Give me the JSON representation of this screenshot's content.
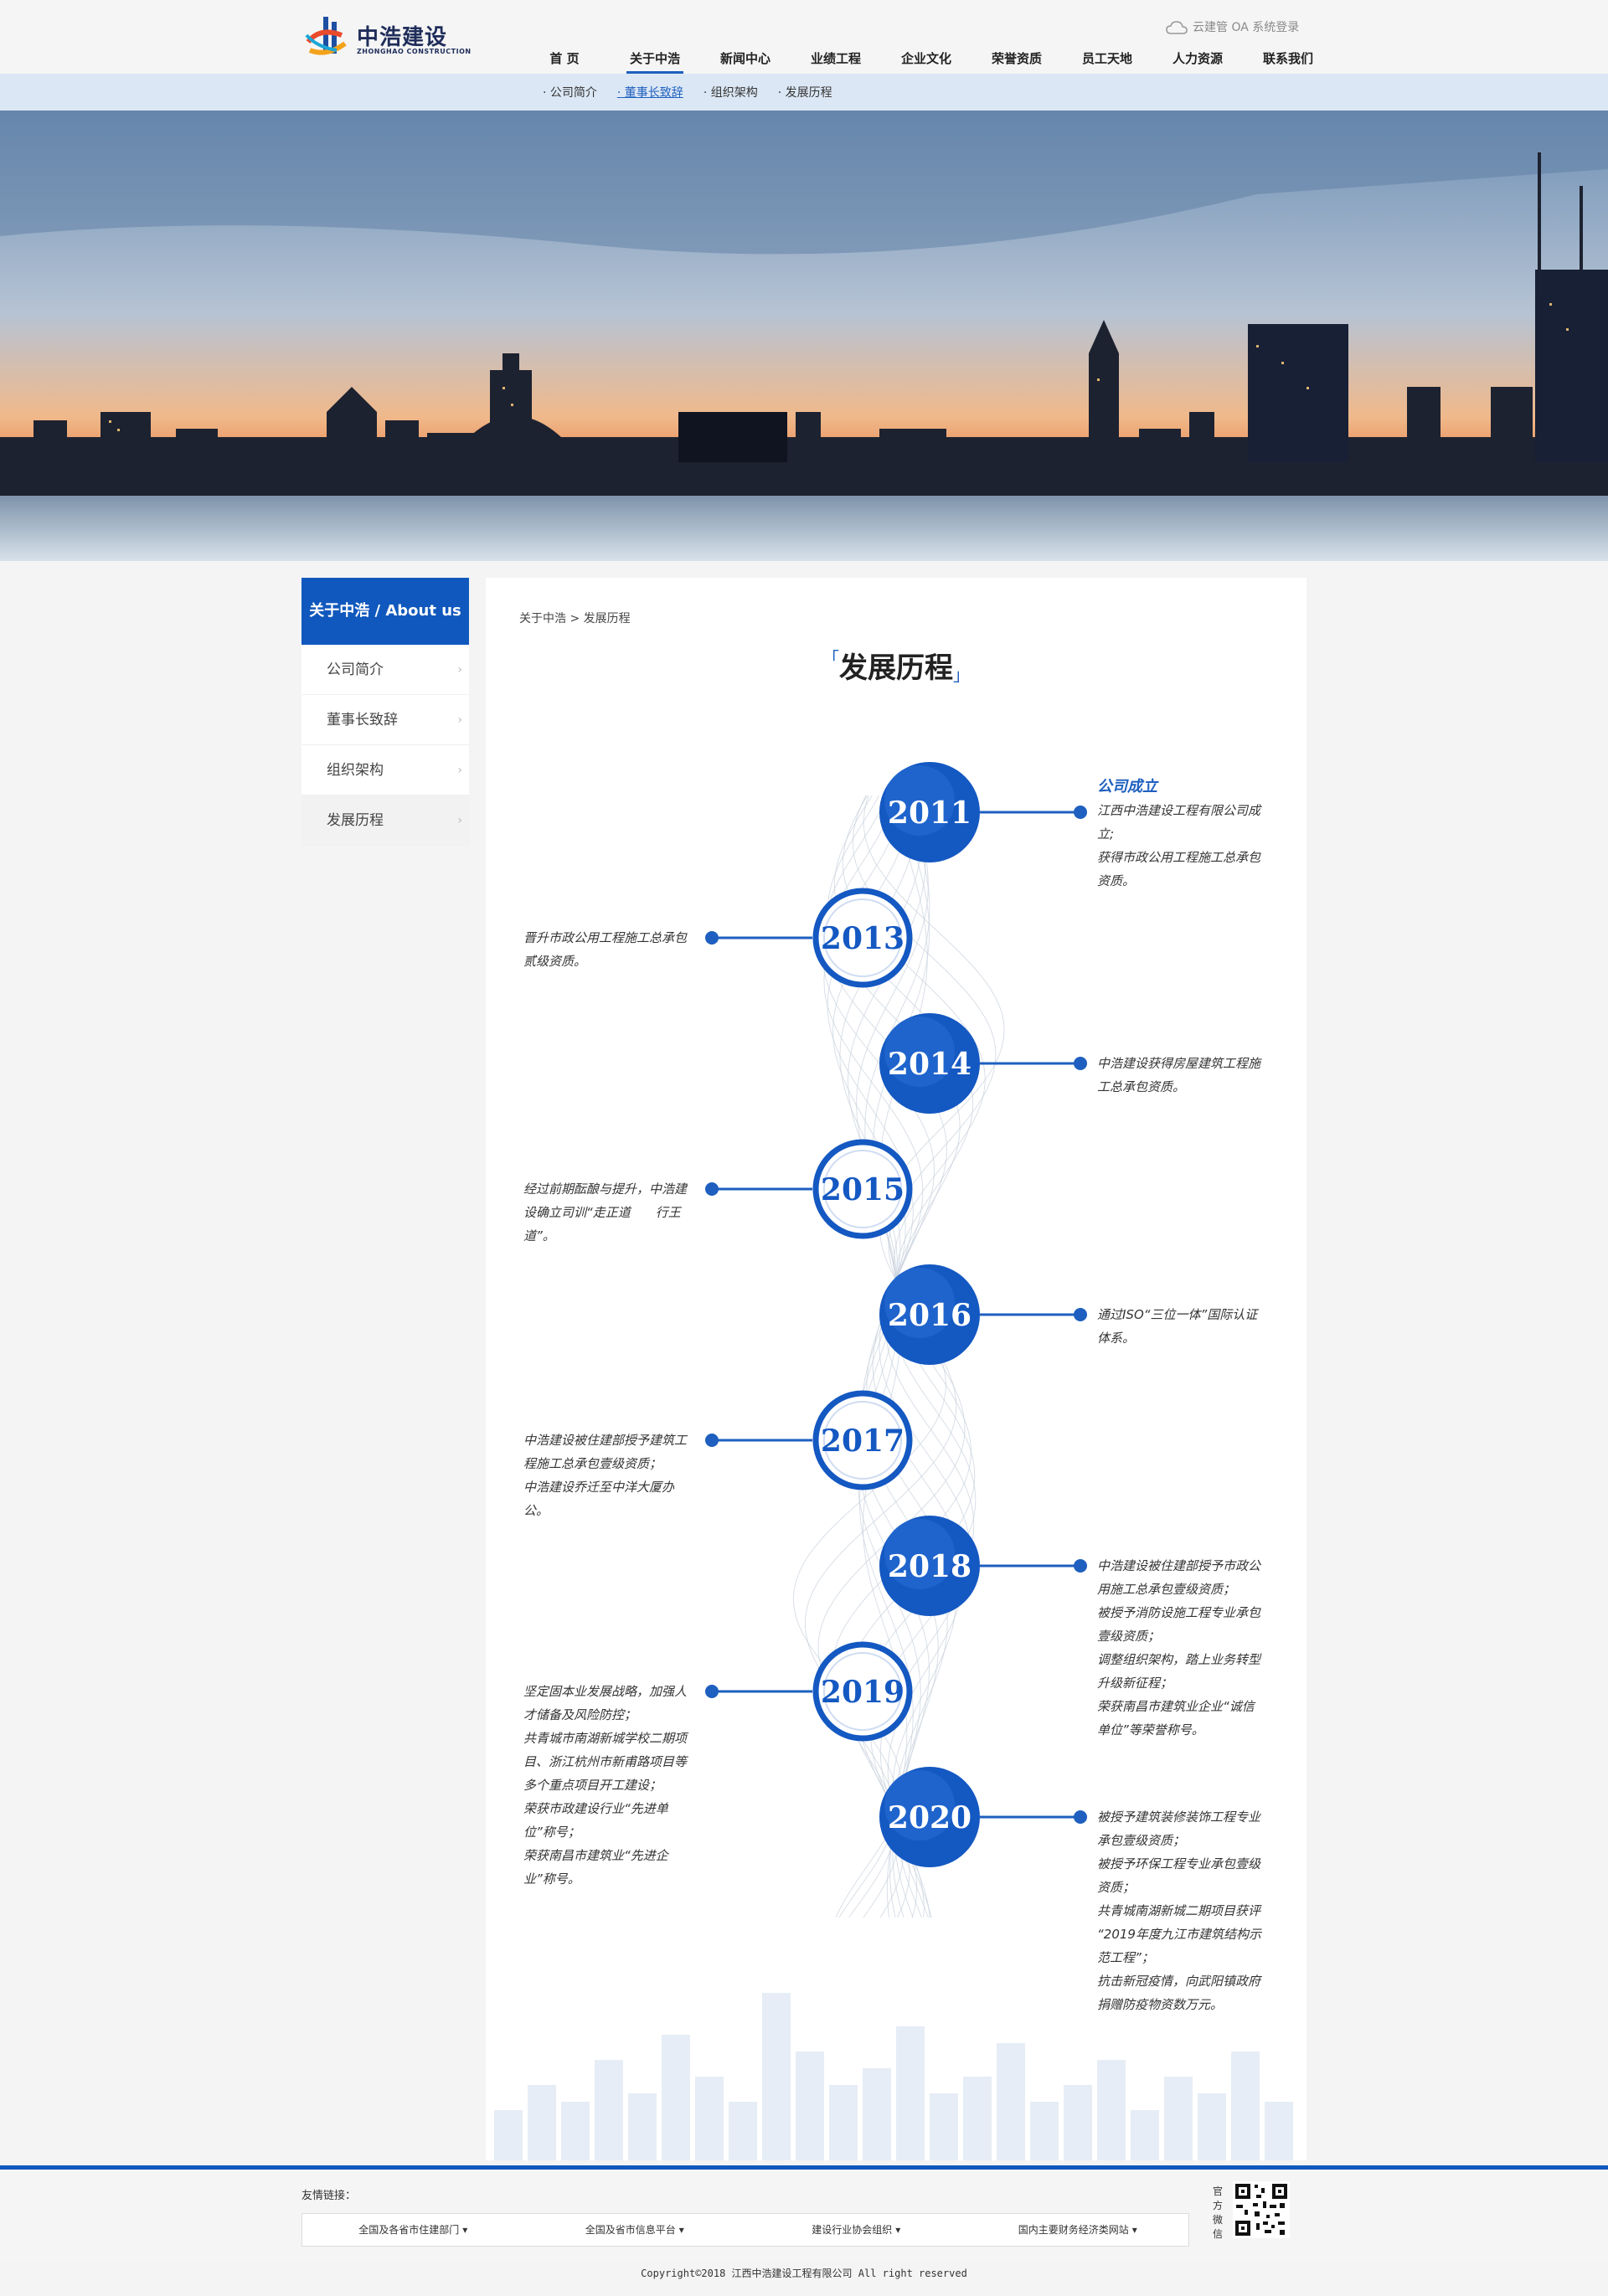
{
  "header": {
    "logo_title": "中浩建设",
    "logo_sub": "ZHONGHAO CONSTRUCTION",
    "top_link": "云建管 OA 系统登录",
    "nav": [
      "首 页",
      "关于中浩",
      "新闻中心",
      "业绩工程",
      "企业文化",
      "荣誉资质",
      "员工天地",
      "人力资源",
      "联系我们"
    ],
    "active_nav": 1
  },
  "subnav": {
    "items": [
      "· 公司简介",
      "· 董事长致辞",
      "· 组织架构",
      "· 发展历程"
    ],
    "active": 1
  },
  "sidebar": {
    "title": "关于中浩 / About us",
    "items": [
      "公司简介",
      "董事长致辞",
      "组织架构",
      "发展历程"
    ],
    "active": 3,
    "chevron": "›"
  },
  "content": {
    "breadcrumb": "关于中浩 > 发展历程",
    "title": "发展历程"
  },
  "timeline": [
    {
      "year": "2011",
      "side": "right",
      "style": "filled",
      "title": "公司成立",
      "lines": [
        "江西中浩建设工程有限公司成",
        "立;",
        "获得市政公用工程施工总承包",
        "资质。"
      ]
    },
    {
      "year": "2013",
      "side": "left",
      "style": "outline",
      "title": "",
      "lines": [
        "晋升市政公用工程施工总承包",
        "贰级资质。"
      ]
    },
    {
      "year": "2014",
      "side": "right",
      "style": "filled",
      "title": "",
      "lines": [
        "中浩建设获得房屋建筑工程施",
        "工总承包资质。"
      ]
    },
    {
      "year": "2015",
      "side": "left",
      "style": "outline",
      "title": "",
      "lines": [
        "经过前期酝酿与提升，中浩建",
        "设确立司训“走正道　　行王",
        "道”。"
      ]
    },
    {
      "year": "2016",
      "side": "right",
      "style": "filled",
      "title": "",
      "lines": [
        "通过ISO“三位一体”国际认证",
        "体系。"
      ]
    },
    {
      "year": "2017",
      "side": "left",
      "style": "outline",
      "title": "",
      "lines": [
        "中浩建设被住建部授予建筑工",
        "程施工总承包壹级资质；",
        "中浩建设乔迁至中洋大厦办",
        "公。"
      ]
    },
    {
      "year": "2018",
      "side": "right",
      "style": "filled",
      "title": "",
      "lines": [
        "中浩建设被住建部授予市政公",
        "用施工总承包壹级资质；",
        "被授予消防设施工程专业承包",
        "壹级资质；",
        "调整组织架构，踏上业务转型",
        "升级新征程；",
        "荣获南昌市建筑业企业“诚信",
        "单位”等荣誉称号。"
      ]
    },
    {
      "year": "2019",
      "side": "left",
      "style": "outline",
      "title": "",
      "lines": [
        "坚定固本业发展战略，加强人",
        "才储备及风险防控；",
        "共青城市南湖新城学校二期项",
        "目、浙江杭州市新甫路项目等",
        "多个重点项目开工建设；",
        "荣获市政建设行业“先进单",
        "位”称号；",
        "荣获南昌市建筑业“先进企",
        "业”称号。"
      ]
    },
    {
      "year": "2020",
      "side": "right",
      "style": "filled",
      "title": "",
      "lines": [
        "被授予建筑装修装饰工程专业",
        "承包壹级资质；",
        "被授予环保工程专业承包壹级",
        "资质；",
        "共青城南湖新城二期项目获评",
        "“2019年度九江市建筑结构示",
        "范工程”；",
        "抗击新冠疫情，向武阳镇政府",
        "捐赠防疫物资数万元。"
      ]
    }
  ],
  "footer": {
    "links_label": "友情链接：",
    "links": [
      "全国及各省市住建部门",
      "全国及省市信息平台",
      "建设行业协会组织",
      "国内主要财务经济类网站"
    ],
    "dropdown_arrow": "▾",
    "qr_label": "官方微信",
    "copyright": "Copyright©2018 江西中浩建设工程有限公司 All right reserved"
  },
  "colors": {
    "primary": "#1058bd",
    "accent": "#1e5fbf",
    "subnav_bg": "#dbe7f4"
  }
}
